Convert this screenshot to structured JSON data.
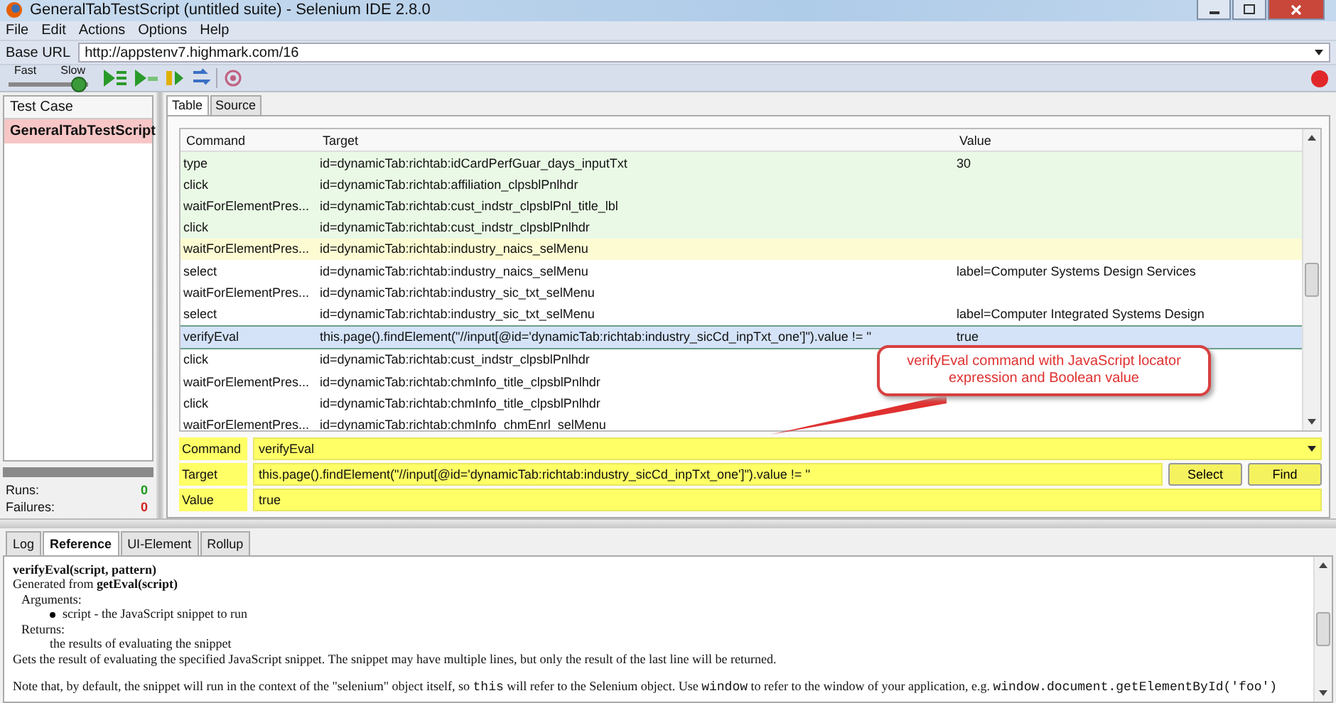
{
  "window": {
    "title": "GeneralTabTestScript (untitled suite) - Selenium IDE 2.8.0"
  },
  "menu": [
    {
      "label": "File"
    },
    {
      "label": "Edit"
    },
    {
      "label": "Actions"
    },
    {
      "label": "Options"
    },
    {
      "label": "Help"
    }
  ],
  "base_url": {
    "label": "Base URL",
    "value": "http://appstenv7.highmark.com/16"
  },
  "speed": {
    "fast": "Fast",
    "slow": "Slow",
    "level": 1
  },
  "test_cases": {
    "header": "Test Case",
    "items": [
      {
        "name": "GeneralTabTestScript",
        "selected": true
      }
    ]
  },
  "stats": {
    "progress": {
      "level": 0
    },
    "runs": {
      "label": "Runs:",
      "value": "0"
    },
    "failures": {
      "label": "Failures:",
      "value": "0"
    }
  },
  "editor_tabs": [
    {
      "label": "Table",
      "selected": true
    },
    {
      "label": "Source",
      "selected": false
    }
  ],
  "table": {
    "columns": [
      "Command",
      "Target",
      "Value"
    ],
    "rows": [
      {
        "command": "type",
        "target": "id=dynamicTab:richtab:idCardPerfGuar_days_inputTxt",
        "value": "30",
        "passed": true,
        "current": false,
        "selected": false
      },
      {
        "command": "click",
        "target": "id=dynamicTab:richtab:affiliation_clpsblPnlhdr",
        "value": "",
        "passed": true,
        "current": false,
        "selected": false
      },
      {
        "command": "waitForElementPres...",
        "target": "id=dynamicTab:richtab:cust_indstr_clpsblPnl_title_lbl",
        "value": "",
        "passed": true,
        "current": false,
        "selected": false
      },
      {
        "command": "click",
        "target": "id=dynamicTab:richtab:cust_indstr_clpsblPnlhdr",
        "value": "",
        "passed": true,
        "current": false,
        "selected": false
      },
      {
        "command": "waitForElementPres...",
        "target": "id=dynamicTab:richtab:industry_naics_selMenu",
        "value": "",
        "passed": false,
        "current": true,
        "selected": false
      },
      {
        "command": "select",
        "target": "id=dynamicTab:richtab:industry_naics_selMenu",
        "value": "label=Computer Systems Design Services",
        "passed": false,
        "current": false,
        "selected": false
      },
      {
        "command": "waitForElementPres...",
        "target": "id=dynamicTab:richtab:industry_sic_txt_selMenu",
        "value": "",
        "passed": false,
        "current": false,
        "selected": false
      },
      {
        "command": "select",
        "target": "id=dynamicTab:richtab:industry_sic_txt_selMenu",
        "value": "label=Computer Integrated Systems Design",
        "passed": false,
        "current": false,
        "selected": false
      },
      {
        "command": "verifyEval",
        "target": "this.page().findElement(\"//input[@id='dynamicTab:richtab:industry_sicCd_inpTxt_one']\").value != ''",
        "value": "true",
        "passed": false,
        "current": false,
        "selected": true
      },
      {
        "command": "click",
        "target": "id=dynamicTab:richtab:cust_indstr_clpsblPnlhdr",
        "value": "",
        "passed": false,
        "current": false,
        "selected": false
      },
      {
        "command": "waitForElementPres...",
        "target": "id=dynamicTab:richtab:chmInfo_title_clpsblPnlhdr",
        "value": "",
        "passed": false,
        "current": false,
        "selected": false
      },
      {
        "command": "click",
        "target": "id=dynamicTab:richtab:chmInfo_title_clpsblPnlhdr",
        "value": "",
        "passed": false,
        "current": false,
        "selected": false
      },
      {
        "command": "waitForElementPres...",
        "target": "id=dynamicTab:richtab:chmInfo_chmEnrl_selMenu",
        "value": "",
        "passed": false,
        "current": false,
        "selected": false
      }
    ]
  },
  "callout": {
    "text": "verifyEval command with JavaScript locator expression and Boolean value"
  },
  "command_editor": {
    "command": {
      "label": "Command",
      "value": "verifyEval"
    },
    "target": {
      "label": "Target",
      "value": "this.page().findElement(\"//input[@id='dynamicTab:richtab:industry_sicCd_inpTxt_one']\").value != ''"
    },
    "value": {
      "label": "Value",
      "value": "true"
    },
    "buttons": [
      "Select",
      "Find"
    ]
  },
  "bottom_tabs": [
    {
      "label": "Log",
      "selected": false
    },
    {
      "label": "Reference",
      "selected": true
    },
    {
      "label": "UI-Element",
      "selected": false
    },
    {
      "label": "Rollup",
      "selected": false
    }
  ],
  "reference": {
    "signature": "verifyEval(script, pattern)",
    "generated": "Generated from **getEval(script)**",
    "arguments_label": "Arguments:",
    "arguments": [
      "script - the JavaScript snippet to run"
    ],
    "returns_label": "Returns:",
    "returns": "the results of evaluating the snippet",
    "description": "Gets the result of evaluating the specified JavaScript snippet. The snippet may have multiple lines, but only the result of the last line will be returned.",
    "note": [
      {
        "kind": "text",
        "text": "Note that, by default, the snippet will run in the context of the \"selenium\" object itself, so "
      },
      {
        "kind": "code",
        "text": "this"
      },
      {
        "kind": "text",
        "text": " will refer to the Selenium object. Use "
      },
      {
        "kind": "code",
        "text": "window"
      },
      {
        "kind": "text",
        "text": " to refer to the window of your application, e.g. "
      },
      {
        "kind": "code",
        "text": "window.document.getElementById('foo')"
      }
    ]
  }
}
